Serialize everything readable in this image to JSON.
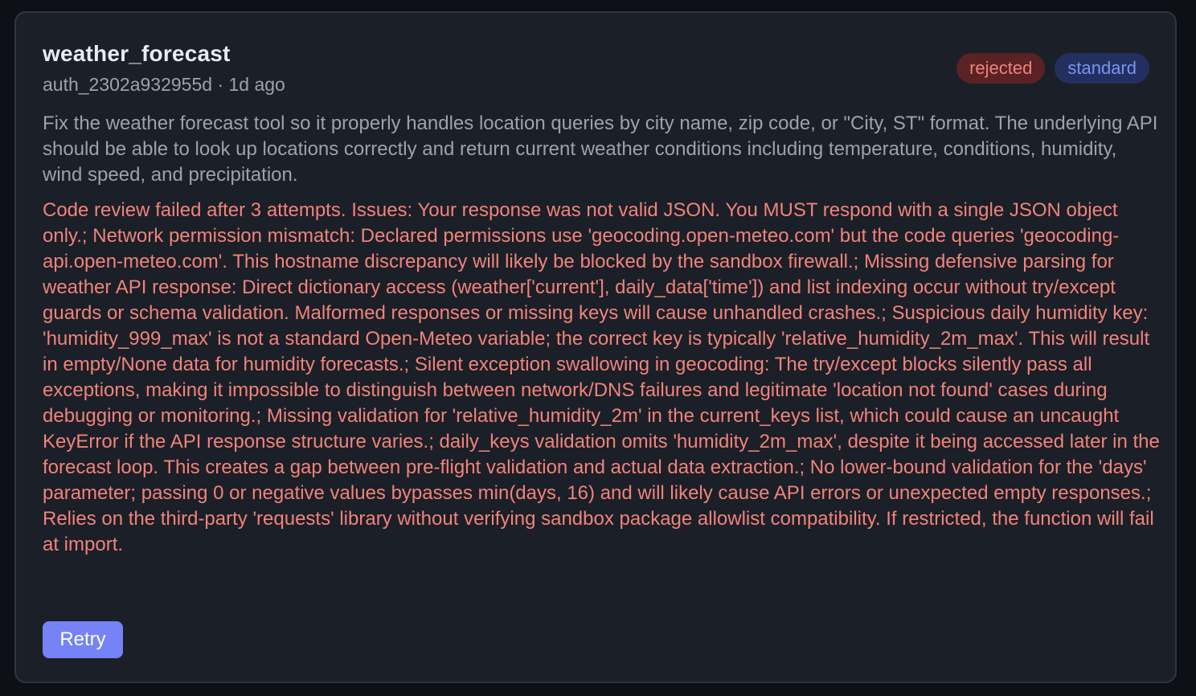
{
  "card": {
    "title": "weather_forecast",
    "meta": "auth_2302a932955d · 1d ago",
    "badges": {
      "status": "rejected",
      "tier": "standard"
    },
    "description": "Fix the weather forecast tool so it properly handles location queries by city name, zip code, or \"City, ST\" format. The underlying API should be able to look up locations correctly and return current weather conditions including temperature, conditions, humidity, wind speed, and precipitation.",
    "error": "Code review failed after 3 attempts. Issues: Your response was not valid JSON. You MUST respond with a single JSON object only.; Network permission mismatch: Declared permissions use 'geocoding.open-meteo.com' but the code queries 'geocoding-api.open-meteo.com'. This hostname discrepancy will likely be blocked by the sandbox firewall.; Missing defensive parsing for weather API response: Direct dictionary access (weather['current'], daily_data['time']) and list indexing occur without try/except guards or schema validation. Malformed responses or missing keys will cause unhandled crashes.; Suspicious daily humidity key: 'humidity_999_max' is not a standard Open-Meteo variable; the correct key is typically 'relative_humidity_2m_max'. This will result in empty/None data for humidity forecasts.; Silent exception swallowing in geocoding: The try/except blocks silently pass all exceptions, making it impossible to distinguish between network/DNS failures and legitimate 'location not found' cases during debugging or monitoring.; Missing validation for 'relative_humidity_2m' in the current_keys list, which could cause an uncaught KeyError if the API response structure varies.; daily_keys validation omits 'humidity_2m_max', despite it being accessed later in the forecast loop. This creates a gap between pre-flight validation and actual data extraction.; No lower-bound validation for the 'days' parameter; passing 0 or negative values bypasses min(days, 16) and will likely cause API errors or unexpected empty responses.; Relies on the third-party 'requests' library without verifying sandbox package allowlist compatibility. If restricted, the function will fail at import.",
    "retry_label": "Retry"
  },
  "colors": {
    "background": "#0d1117",
    "card": "#1b1f27",
    "error_text": "#f0837b",
    "rejected_badge_bg": "#5a2224",
    "standard_badge_bg": "#23305f",
    "standard_badge_text": "#7b93f2",
    "retry_button": "#7583f7"
  }
}
